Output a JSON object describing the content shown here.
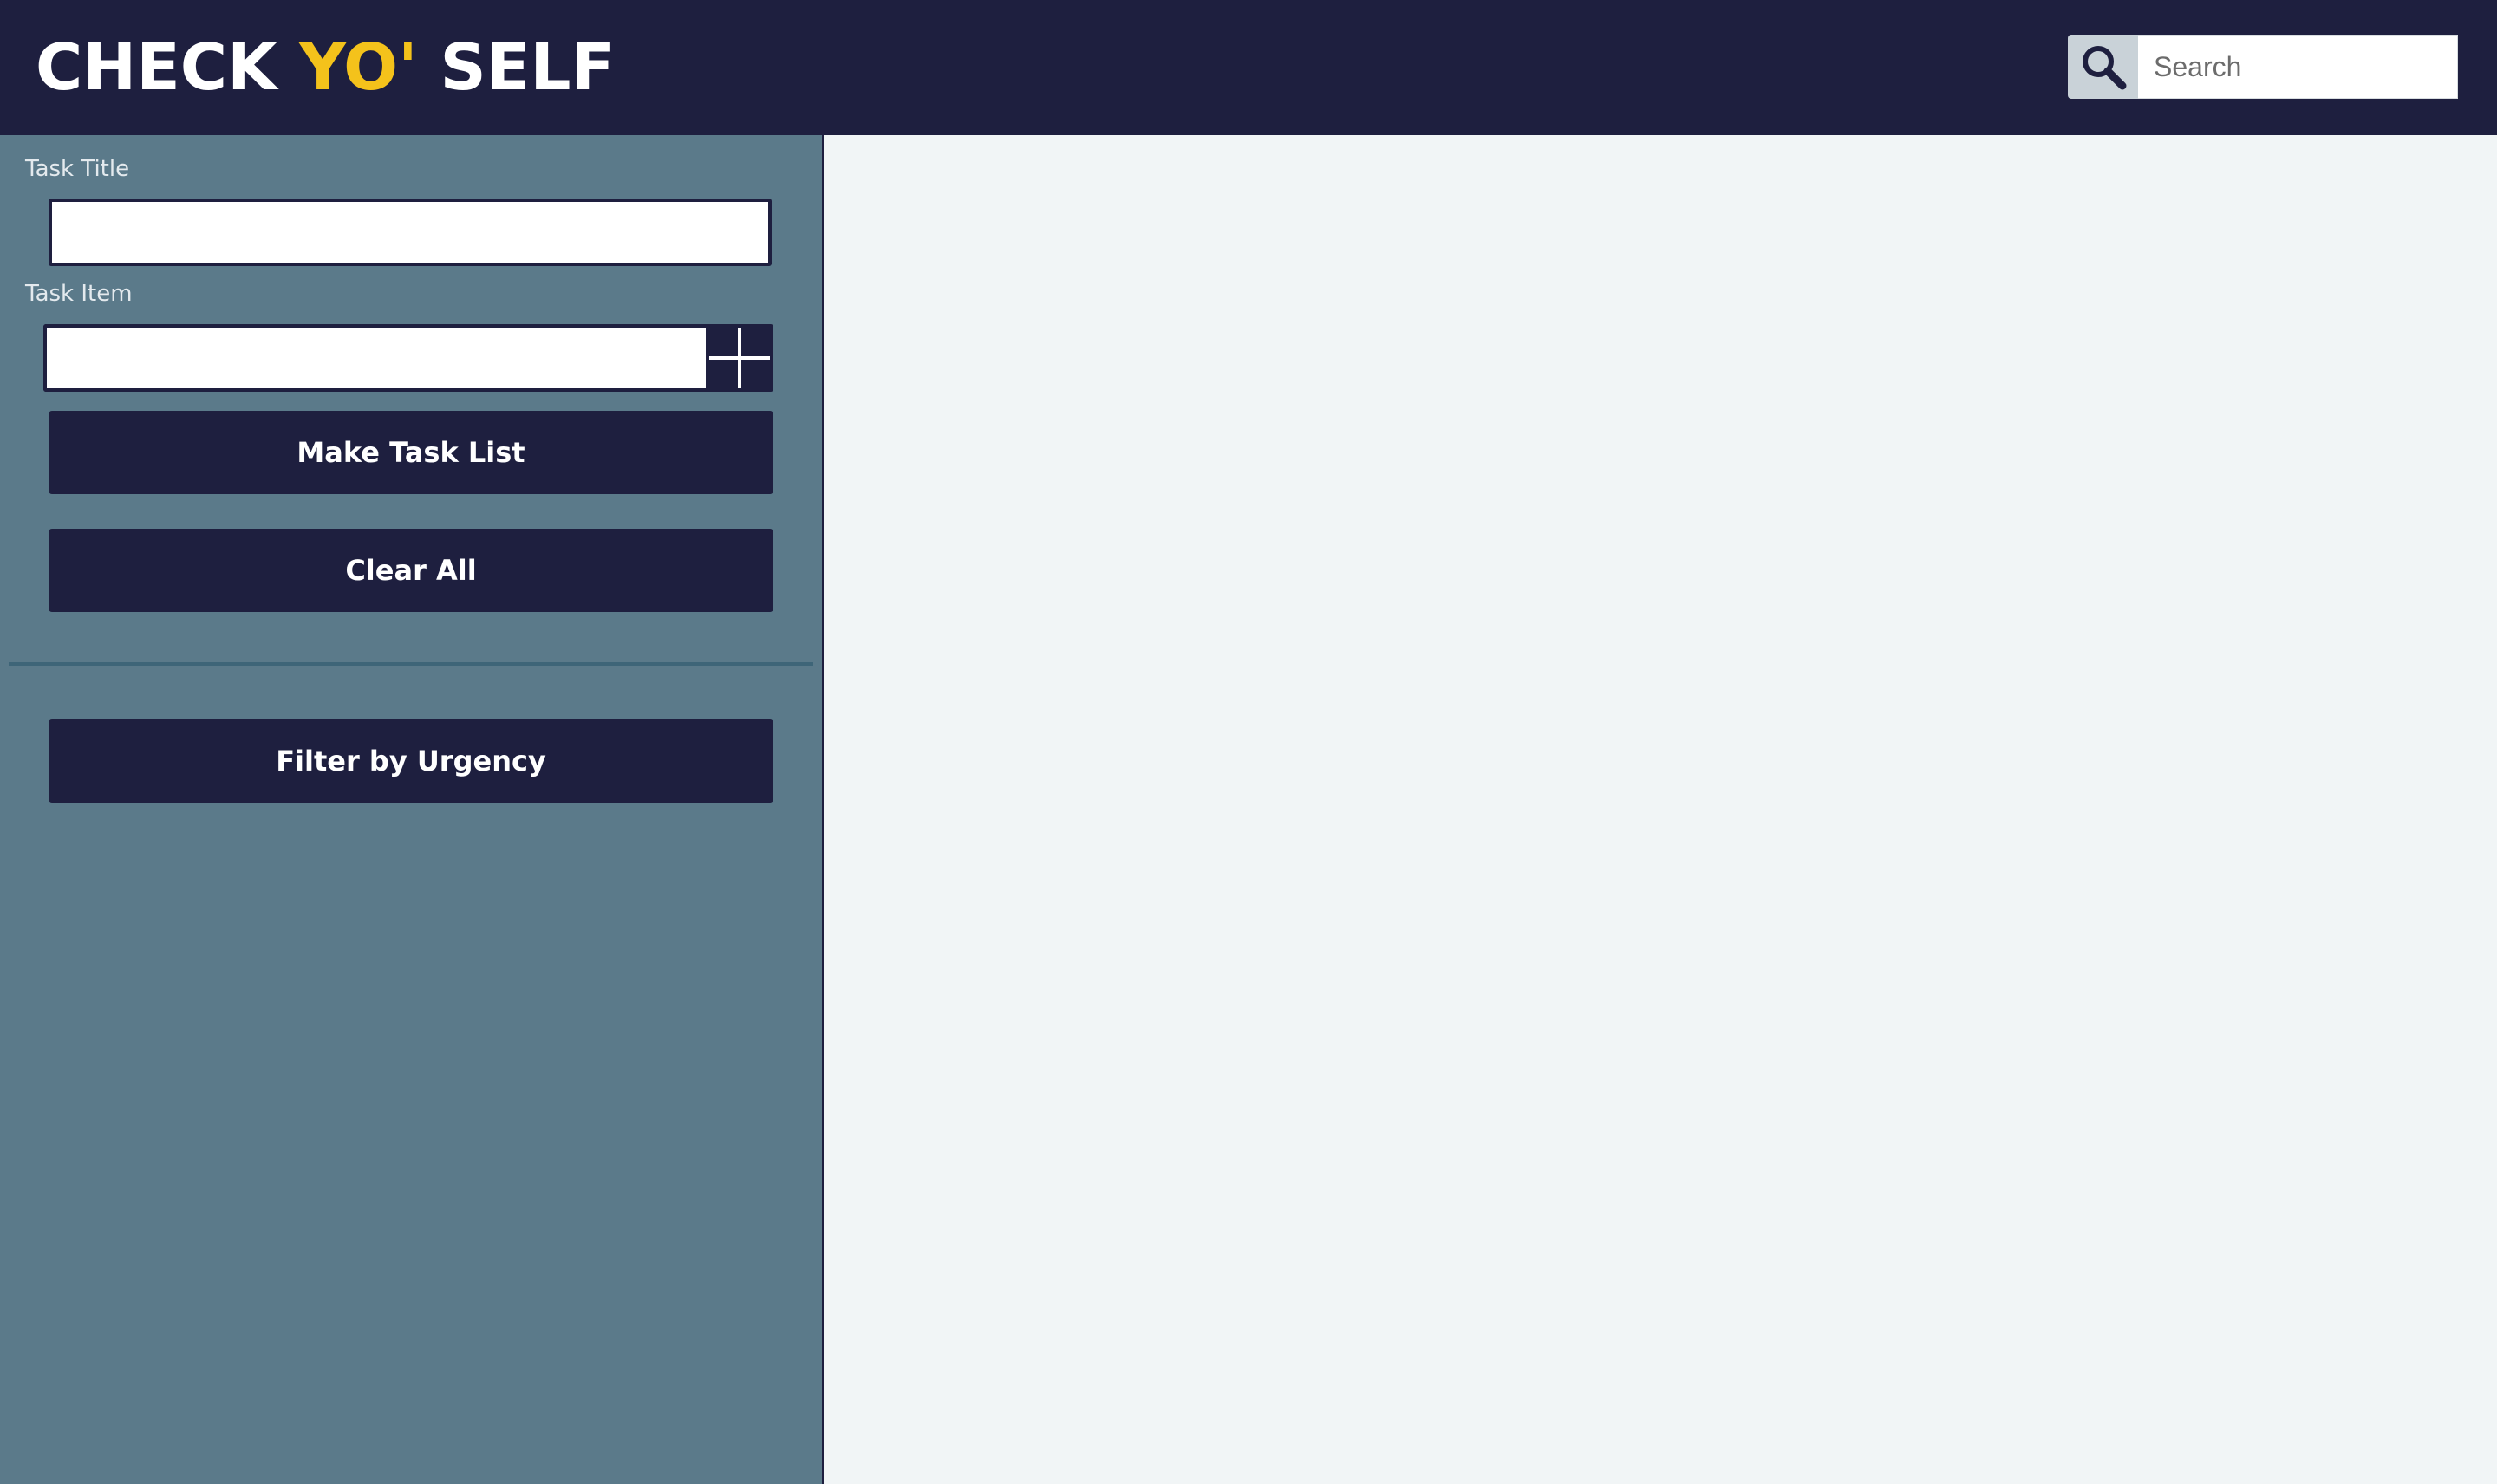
{
  "header": {
    "logo_part1": "CHECK ",
    "logo_accent": "YO'",
    "logo_part2": " SELF",
    "search_placeholder": "Search",
    "search_icon": "magnifier-icon"
  },
  "sidebar": {
    "task_title_label": "Task Title",
    "task_title_value": "",
    "task_item_label": "Task Item",
    "task_item_value": "",
    "add_item_icon": "plus-icon",
    "make_task_list_label": "Make Task List",
    "clear_all_label": "Clear All",
    "filter_label": "Filter by Urgency"
  },
  "colors": {
    "header_bg": "#1e1f3f",
    "accent": "#f4c21b",
    "sidebar_bg": "#5b7a8a",
    "main_bg": "#f1f5f6",
    "button_bg": "#1e1f3f"
  }
}
